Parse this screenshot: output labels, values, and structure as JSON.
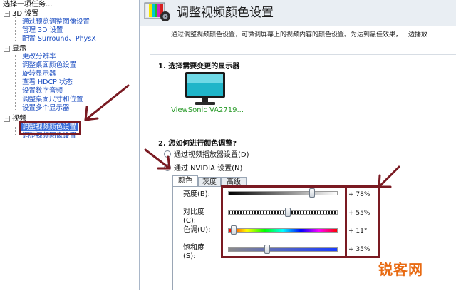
{
  "sidebar": {
    "task_header": "选择一项任务...",
    "groups": [
      {
        "label": "3D 设置",
        "items": [
          "通过预览调整图像设置",
          "管理 3D 设置",
          "配置 Surround、PhysX"
        ]
      },
      {
        "label": "显示",
        "items": [
          "更改分辨率",
          "调整桌面颜色设置",
          "旋转显示器",
          "查看 HDCP 状态",
          "设置数字音频",
          "调整桌面尺寸和位置",
          "设置多个显示器"
        ]
      },
      {
        "label": "视频",
        "items": [
          "调整视频颜色设置",
          "调整视频图像设置"
        ]
      }
    ],
    "collapse_glyph": "−"
  },
  "header": {
    "title": "调整视频颜色设置"
  },
  "intro": "通过调整视频颜色设置，可微调屏幕上的视频内容的颜色设置。为达到最佳效果，一边播放一",
  "section1": {
    "title": "1. 选择需要变更的显示器",
    "monitor_label": "ViewSonic VA2719..."
  },
  "section2": {
    "title": "2. 您如何进行颜色调整?",
    "options": [
      {
        "label": "通过视频播放器设置(D)",
        "selected": false
      },
      {
        "label": "通过 NVIDIA 设置(N)",
        "selected": true
      }
    ]
  },
  "tabs": [
    {
      "label": "颜色",
      "active": true
    },
    {
      "label": "灰度",
      "active": false
    },
    {
      "label": "高级",
      "active": false
    }
  ],
  "sliders": [
    {
      "label_line1": "亮度(B):",
      "label_line2": "",
      "value_text": "+ 78%",
      "level": 0.78
    },
    {
      "label_line1": "对比度",
      "label_line2": "(C):",
      "value_text": "+ 55%",
      "level": 0.55
    },
    {
      "label_line1": "色调(U):",
      "label_line2": "",
      "value_text": "+ 11°",
      "level": 0.03
    },
    {
      "label_line1": "饱和度",
      "label_line2": "(S):",
      "value_text": "+ 35%",
      "level": 0.35
    }
  ],
  "icons": {
    "title": "color-settings-icon",
    "monitor": "monitor-icon",
    "annotation": "red-arrow-icon"
  },
  "colors": {
    "annotation_red": "#7a1a22",
    "link_blue": "#1c4ec2",
    "selection_blue": "#3a6ed9",
    "monitor_label_green": "#2a9b2a",
    "header_bg": "#e9eef3"
  },
  "watermark": {
    "text": "锐客网"
  }
}
